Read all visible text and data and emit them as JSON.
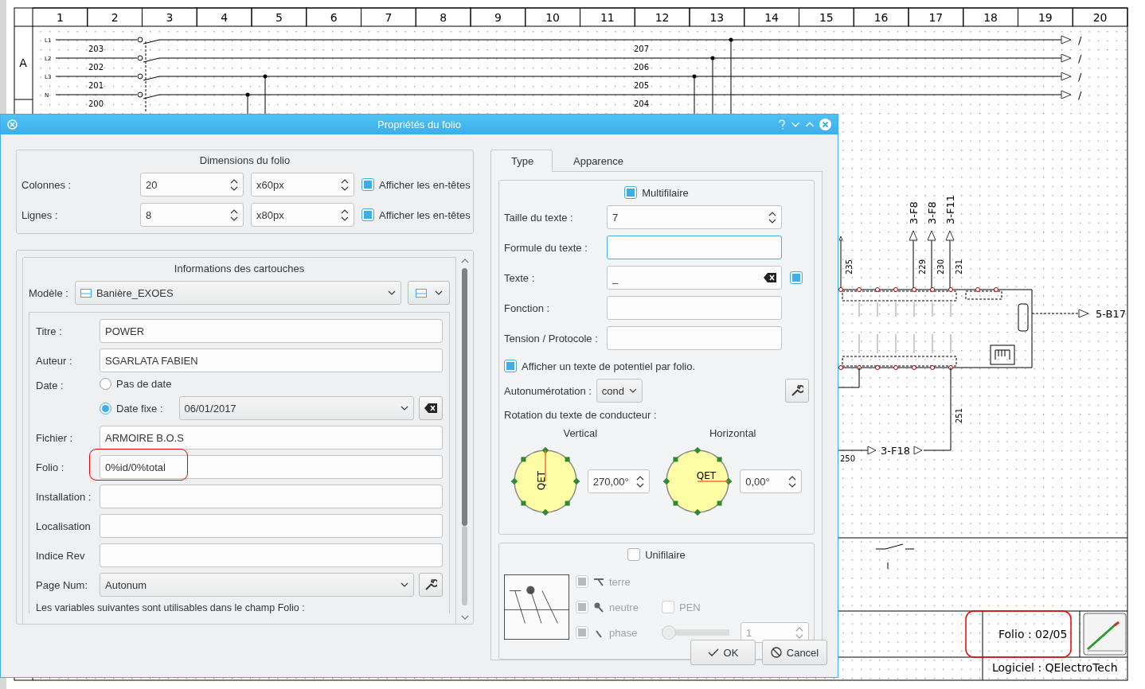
{
  "sheet": {
    "columns": [
      "1",
      "2",
      "3",
      "4",
      "5",
      "6",
      "7",
      "8",
      "9",
      "10",
      "11",
      "12",
      "13",
      "14",
      "15",
      "16",
      "17",
      "18",
      "19",
      "20"
    ],
    "rows": [
      "A"
    ],
    "wires": [
      {
        "label": "L1",
        "left_number": "203",
        "right_number": "207",
        "end_mark": "/"
      },
      {
        "label": "L2",
        "left_number": "202",
        "right_number": "206",
        "end_mark": "/"
      },
      {
        "label": "L3",
        "left_number": "201",
        "right_number": "205",
        "end_mark": "/"
      },
      {
        "label": "N",
        "left_number": "200",
        "right_number": "204",
        "end_mark": "/"
      }
    ],
    "bus_labels": [
      "3-F8",
      "3-F8",
      "3-F11"
    ],
    "wire_numbers": [
      "235",
      "229",
      "230",
      "231"
    ],
    "output_reference": "5-B17",
    "return_reference": "3-F18",
    "bottom_numbers": [
      "250",
      "251"
    ],
    "title_block": {
      "folio": "Folio : 02/05",
      "folio_highlighted": true,
      "software": "Logiciel : QElectroTech"
    }
  },
  "dialog": {
    "title": "Propriétés du folio",
    "dimensions": {
      "title": "Dimensions du folio",
      "rows": [
        {
          "label": "Colonnes :",
          "count": "20",
          "size": "x60px",
          "headers_label": "Afficher les en-têtes",
          "checked": true
        },
        {
          "label": "Lignes :",
          "count": "8",
          "size": "x80px",
          "headers_label": "Afficher les en-têtes",
          "checked": true
        }
      ]
    },
    "cartouche": {
      "title": "Informations des cartouches",
      "model_label": "Modèle :",
      "model": "Banière_EXOES",
      "fields": [
        {
          "kind": "text",
          "label": "Titre :",
          "value": "POWER"
        },
        {
          "kind": "text",
          "label": "Auteur :",
          "value": "SGARLATA FABIEN"
        },
        {
          "kind": "date",
          "label": "Date :",
          "options": [
            {
              "label": "Pas de date",
              "selected": false
            },
            {
              "label": "Date fixe :",
              "selected": true
            }
          ],
          "value": "06/01/2017"
        },
        {
          "kind": "text",
          "label": "Fichier :",
          "value": "ARMOIRE B.O.S"
        },
        {
          "kind": "text",
          "label": "Folio :",
          "value": "0%id/0%total",
          "highlighted": true
        },
        {
          "kind": "text",
          "label": "Installation :",
          "highlighted": false
        },
        {
          "kind": "text",
          "label": "Localisation",
          "highlighted": false
        },
        {
          "kind": "text",
          "label": "Indice Rev",
          "highlighted": false
        },
        {
          "kind": "select",
          "label": "Page Num:",
          "value": "Autonum"
        }
      ],
      "note": "Les variables suivantes sont utilisables dans le champ Folio :"
    },
    "tabs": [
      {
        "label": "Type",
        "selected": true
      },
      {
        "label": "Apparence",
        "selected": false
      }
    ],
    "multi": {
      "label": "Multifilaire",
      "checked": true,
      "fields": [
        {
          "kind": "spin",
          "label": "Taille du texte :",
          "value": "7",
          "focused": false
        },
        {
          "kind": "text",
          "label": "Formule du texte :",
          "focused": true
        },
        {
          "kind": "clearable",
          "label": "Texte :",
          "value": "_",
          "checked": true,
          "focused": false
        },
        {
          "kind": "text",
          "label": "Fonction :",
          "focused": false
        },
        {
          "kind": "text",
          "label": "Tension / Protocole :",
          "focused": false
        }
      ],
      "potential": {
        "label": "Afficher un texte de potentiel par folio.",
        "checked": true
      },
      "autonum_label": "Autonumérotation :",
      "autonum": "cond",
      "rotation_label": "Rotation du texte de conducteur :",
      "dials": [
        {
          "label": "Vertical",
          "kind": "vertical",
          "dial_text": "QET",
          "angle": "270,00°"
        },
        {
          "label": "Horizontal",
          "kind": "horizontal",
          "dial_text": "QET",
          "angle": "0,00°"
        }
      ]
    },
    "uni": {
      "label": "Unifilaire",
      "checked": false,
      "disabled": true,
      "options": [
        {
          "kind": "ground",
          "label": "terre",
          "checked": true
        },
        {
          "kind": "neutral",
          "label": "neutre",
          "checked": true
        },
        {
          "kind": "phase",
          "label": "phase",
          "checked": true
        }
      ],
      "pen": {
        "label": "PEN",
        "checked": false
      },
      "phase_slider": {
        "level": 0
      },
      "phase_count": "1"
    },
    "buttons": [
      {
        "kind": "ok",
        "label": "OK"
      },
      {
        "kind": "cancel",
        "label": "Cancel"
      }
    ]
  }
}
